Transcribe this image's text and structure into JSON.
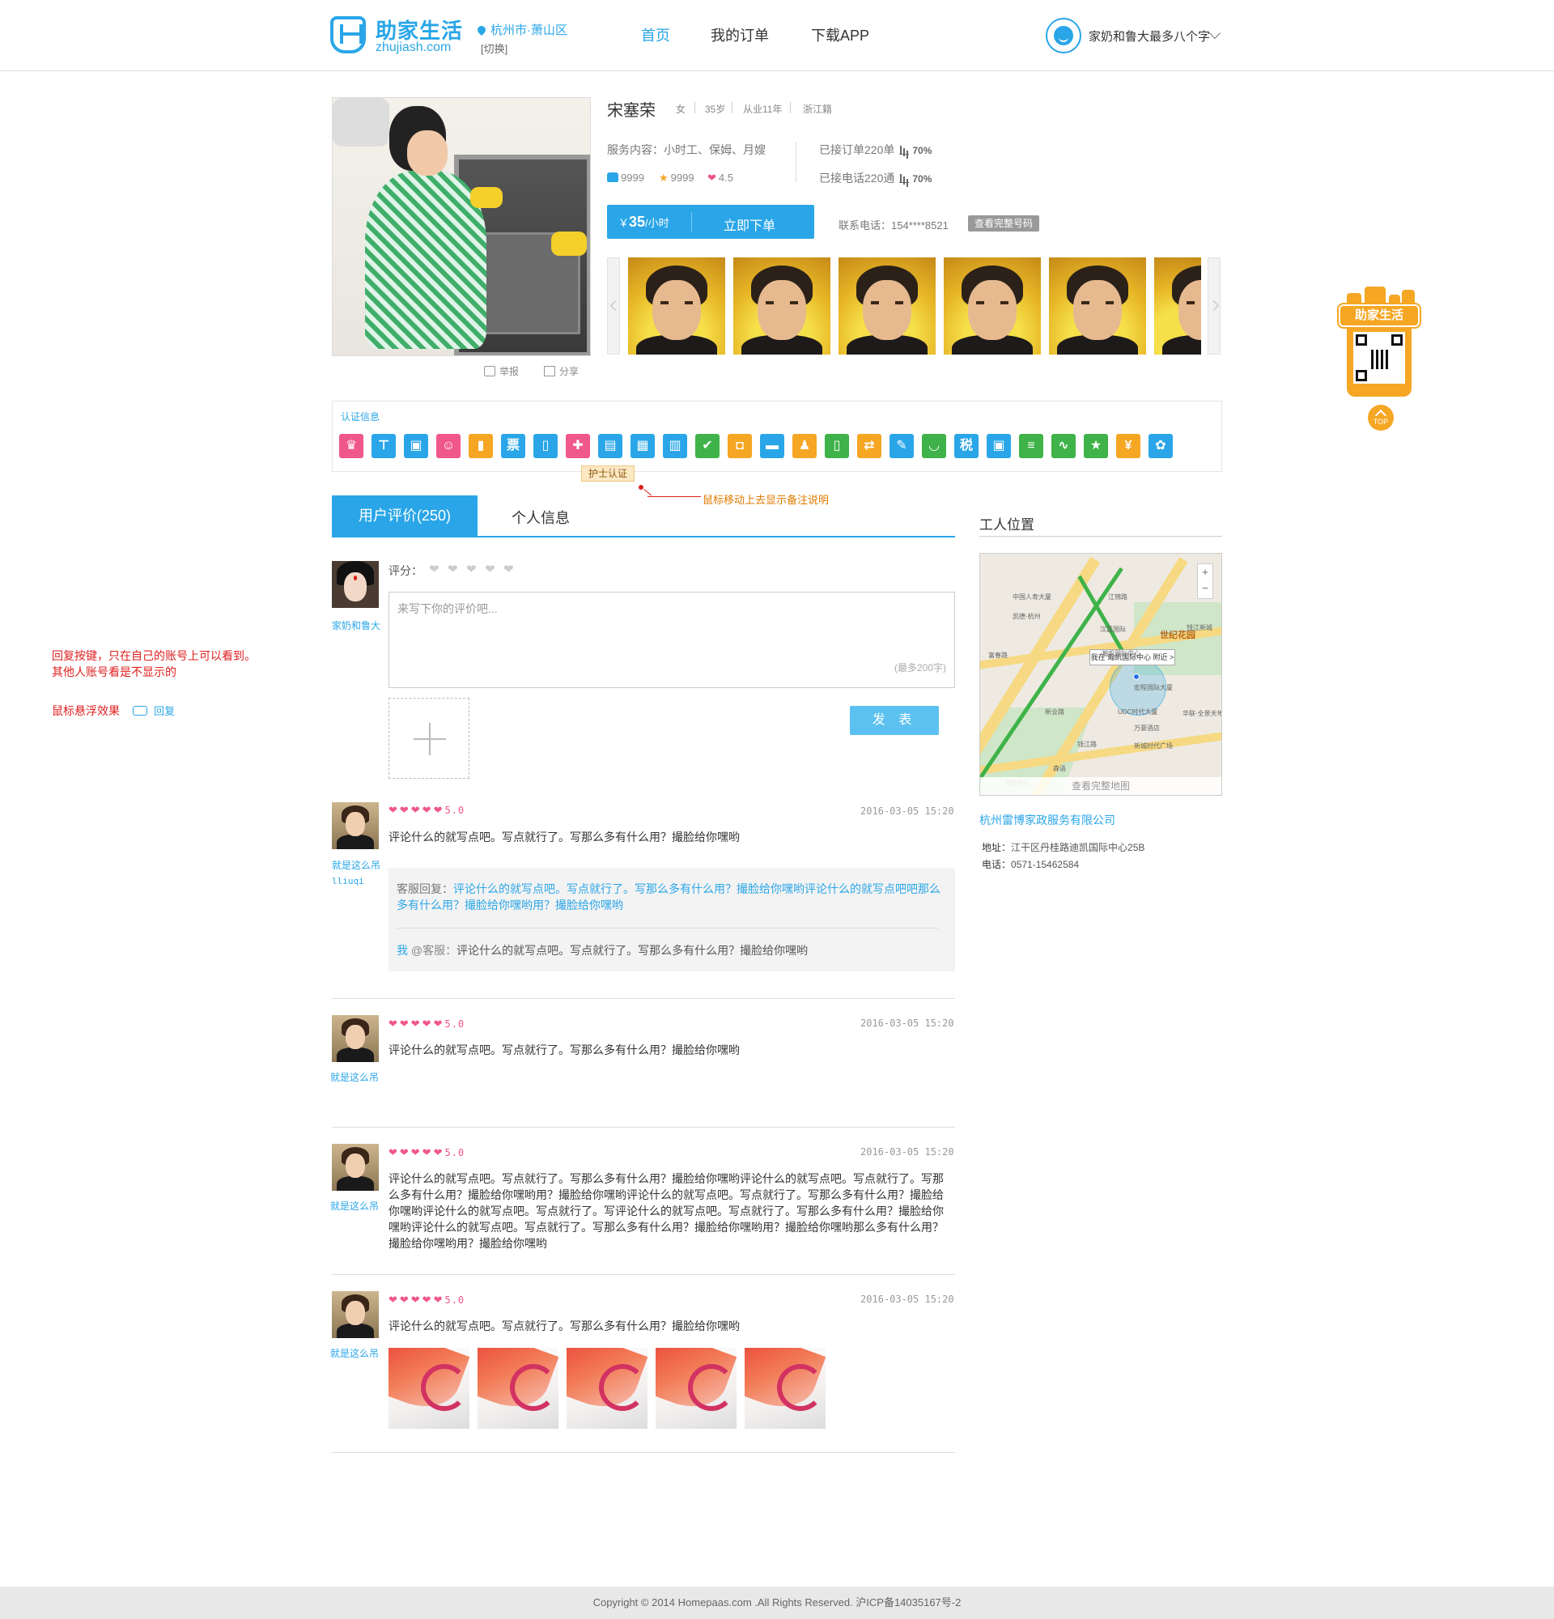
{
  "header": {
    "logo_cn": "助家生活",
    "logo_en": "zhujiash.com",
    "city": "杭州市·萧山区",
    "switch_label": "[切换]",
    "nav": [
      "首页",
      "我的订单",
      "下载APP"
    ],
    "user_name": "家奶和鲁大最多八个字"
  },
  "worker": {
    "name": "宋塞荣",
    "gender": "女",
    "age": "35岁",
    "experience": "从业11年",
    "origin": "浙江籍",
    "service": "服务内容：小时工、保姆、月嫂",
    "orders_label": "已接订单220单",
    "orders_rate": "70%",
    "calls_label": "已接电话220通",
    "calls_rate": "70%",
    "likes": "9999",
    "stars": "9999",
    "rating": "4.5",
    "price": "35",
    "price_prefix": "￥",
    "price_unit": "/小时",
    "order_button": "立即下单",
    "phone": "联系电话：154****8521",
    "phone_button": "查看完整号码",
    "report": "举报",
    "share": "分享"
  },
  "cert": {
    "title": "认证信息",
    "tooltip": "护士认证",
    "note": "鼠标移动上去显示备注说明",
    "icons": [
      {
        "name": "nurse-icon",
        "color": "#f0578a",
        "glyph": "♛"
      },
      {
        "name": "org-icon",
        "color": "#2aa6e8",
        "glyph": "⊤"
      },
      {
        "name": "id-card-icon",
        "color": "#2aa6e8",
        "glyph": "▣"
      },
      {
        "name": "baby-icon",
        "color": "#f0578a",
        "glyph": "☺"
      },
      {
        "name": "bottle-icon",
        "color": "#f5a623",
        "glyph": "▮"
      },
      {
        "name": "ticket-icon",
        "color": "#2aa6e8",
        "glyph": "票"
      },
      {
        "name": "phone-icon",
        "color": "#2aa6e8",
        "glyph": "▯"
      },
      {
        "name": "medical-icon",
        "color": "#f0578a",
        "glyph": "✚"
      },
      {
        "name": "certificate-icon",
        "color": "#2aa6e8",
        "glyph": "▤"
      },
      {
        "name": "license-icon",
        "color": "#2aa6e8",
        "glyph": "▦"
      },
      {
        "name": "card-icon",
        "color": "#2aa6e8",
        "glyph": "▥"
      },
      {
        "name": "person-check-icon",
        "color": "#3fb349",
        "glyph": "✔"
      },
      {
        "name": "box-icon",
        "color": "#f5a623",
        "glyph": "◘"
      },
      {
        "name": "briefcase-icon",
        "color": "#2aa6e8",
        "glyph": "▬"
      },
      {
        "name": "user-badge-icon",
        "color": "#f5a623",
        "glyph": "♟"
      },
      {
        "name": "cup-icon",
        "color": "#3fb349",
        "glyph": "▯"
      },
      {
        "name": "transfer-icon",
        "color": "#f5a623",
        "glyph": "⇄"
      },
      {
        "name": "wrench-icon",
        "color": "#2aa6e8",
        "glyph": "✎"
      },
      {
        "name": "bucket-icon",
        "color": "#3fb349",
        "glyph": "◡"
      },
      {
        "name": "tax-icon",
        "color": "#2aa6e8",
        "glyph": "税"
      },
      {
        "name": "lock-icon",
        "color": "#2aa6e8",
        "glyph": "▣"
      },
      {
        "name": "doc-icon",
        "color": "#3fb349",
        "glyph": "≡"
      },
      {
        "name": "chart-icon",
        "color": "#3fb349",
        "glyph": "∿"
      },
      {
        "name": "star-badge-icon",
        "color": "#3fb349",
        "glyph": "★"
      },
      {
        "name": "money-icon",
        "color": "#f5a623",
        "glyph": "¥"
      },
      {
        "name": "settings-icon",
        "color": "#2aa6e8",
        "glyph": "✿"
      }
    ]
  },
  "tabs": {
    "reviews": "用户评价(250)",
    "info": "个人信息"
  },
  "compose": {
    "user": "家奶和鲁大",
    "rate_label": "评分：",
    "placeholder": "来写下你的评价吧...",
    "limit": "(最多200字)",
    "publish": "发 表"
  },
  "reviews": [
    {
      "user": "就是这么吊",
      "user_id": "lliuqi",
      "score": "5.0",
      "date": "2016-03-05 15:20",
      "text": "评论什么的就写点吧。写点就行了。写那么多有什么用？撮脸给你嘿哟",
      "reply_label": "客服回复：",
      "reply_text": "评论什么的就写点吧。写点就行了。写那么多有什么用？撮脸给你嘿哟评论什么的就写点吧吧那么多有什么用？撮脸给你嘿哟用？撮脸给你嘿哟",
      "me_label": "我",
      "me_at": "@客服：",
      "me_text": "评论什么的就写点吧。写点就行了。写那么多有什么用？撮脸给你嘿哟"
    },
    {
      "user": "就是这么吊",
      "score": "5.0",
      "date": "2016-03-05 15:20",
      "text": "评论什么的就写点吧。写点就行了。写那么多有什么用？撮脸给你嘿哟"
    },
    {
      "user": "就是这么吊",
      "score": "5.0",
      "date": "2016-03-05 15:20",
      "text": "评论什么的就写点吧。写点就行了。写那么多有什么用？撮脸给你嘿哟评论什么的就写点吧。写点就行了。写那么多有什么用？撮脸给你嘿哟用？撮脸给你嘿哟评论什么的就写点吧。写点就行了。写那么多有什么用？撮脸给你嘿哟评论什么的就写点吧。写点就行了。写评论什么的就写点吧。写点就行了。写那么多有什么用？撮脸给你嘿哟评论什么的就写点吧。写点就行了。写那么多有什么用？撮脸给你嘿哟用？撮脸给你嘿哟那么多有什么用？撮脸给你嘿哟用？撮脸给你嘿哟"
    },
    {
      "user": "就是这么吊",
      "score": "5.0",
      "date": "2016-03-05 15:20",
      "text": "评论什么的就写点吧。写点就行了。写那么多有什么用？撮脸给你嘿哟"
    }
  ],
  "side": {
    "title": "工人位置",
    "map_bubble": "我在 瀚凯国际中心 附近 >",
    "map_park": "世纪花园",
    "map_link": "查看完整地图",
    "company": "杭州雷博家政服务有限公司",
    "address_label": "地址：",
    "address": "江干区丹桂路迪凯国际中心25B",
    "tel_label": "电话：",
    "tel": "0571-15462584",
    "map_labels": [
      "中国人寿大厦",
      "江锦路",
      "凯德·杭州",
      "汉嘉国际",
      "钱江新城",
      "瀚凯国际中心",
      "宏程国际大厦",
      "UDC时代大厦",
      "华联·全景天地",
      "万豪酒店",
      "新城时代广场",
      "市民中心",
      "富春路",
      "新业路",
      "钱江路",
      "森语"
    ]
  },
  "float_widget": {
    "brand": "助家生活",
    "top": "TOP"
  },
  "annotation": {
    "line1": "回复按键，只在自己的账号上可以看到。",
    "line2": "其他人账号看是不显示的",
    "hover": "鼠标悬浮效果",
    "reply": "回复"
  },
  "footer": {
    "text": "Copyright © 2014 Homepaas.com .All Rights Reserved. 沪ICP备14035167号-2"
  }
}
